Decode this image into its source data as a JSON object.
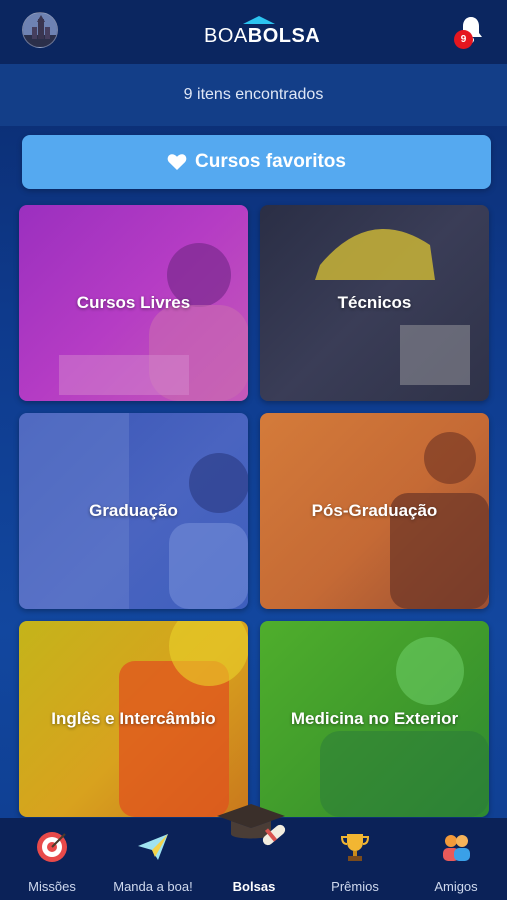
{
  "header": {
    "logo_part1": "BOA",
    "logo_part2": "BOLSA",
    "notification_count": "9"
  },
  "results": {
    "found_text": "9 itens encontrados"
  },
  "favorites_button": {
    "label": "Cursos favoritos",
    "icon": "heart-icon"
  },
  "categories": [
    {
      "label": "Cursos Livres",
      "color": "#b53cc4"
    },
    {
      "label": "Técnicos",
      "color": "#3a3d57"
    },
    {
      "label": "Graduação",
      "color": "#4a64c0"
    },
    {
      "label": "Pós-Graduação",
      "color": "#c56a35"
    },
    {
      "label": "Inglês e Intercâmbio",
      "color": "#d8a21e"
    },
    {
      "label": "Medicina no Exterior",
      "color": "#3f9a2c"
    }
  ],
  "nav": {
    "items": [
      {
        "label": "Missões",
        "icon": "target-icon"
      },
      {
        "label": "Manda a boa!",
        "icon": "paper-plane-icon"
      },
      {
        "label": "Bolsas",
        "icon": "graduation-cap-icon"
      },
      {
        "label": "Prêmios",
        "icon": "trophy-icon"
      },
      {
        "label": "Amigos",
        "icon": "friends-icon"
      }
    ],
    "active": "Bolsas"
  },
  "colors": {
    "background": "#0e3a8c",
    "accent_blue": "#55a9f0",
    "badge_red": "#e5161f",
    "logo_roof": "#2cc4f0"
  }
}
